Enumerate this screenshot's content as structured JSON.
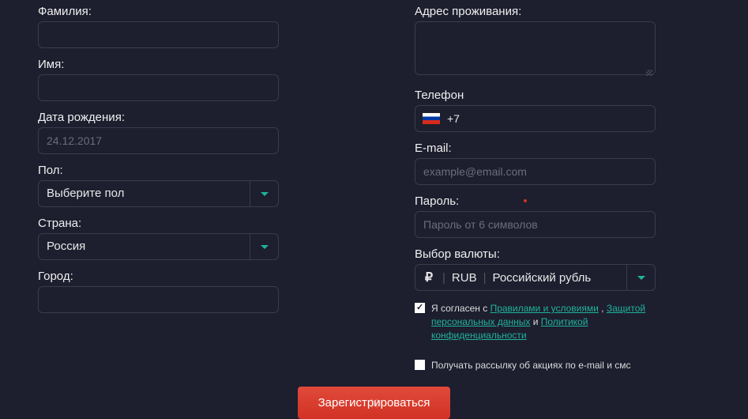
{
  "left": {
    "lastname_label": "Фамилия:",
    "firstname_label": "Имя:",
    "dob_label": "Дата рождения:",
    "dob_placeholder": "24.12.2017",
    "gender_label": "Пол:",
    "gender_value": "Выберите пол",
    "country_label": "Страна:",
    "country_value": "Россия",
    "city_label": "Город:"
  },
  "right": {
    "address_label": "Адрес проживания:",
    "phone_label": "Телефон",
    "phone_prefix": "+7",
    "email_label": "E-mail:",
    "email_placeholder": "example@email.com",
    "password_label": "Пароль:",
    "password_placeholder": "Пароль от 6 символов",
    "currency_label": "Выбор валюты:",
    "currency_code": "RUB",
    "currency_name": "Российский рубль"
  },
  "checks": {
    "agree_prefix": "Я согласен с ",
    "rules_link": "Правилами и условиями",
    "sep1": " , ",
    "privacy_link": "Защитой персональных данных",
    "sep2": " и ",
    "policy_link": "Политикой конфиденциальности",
    "newsletter": "Получать рассылку об акциях по e-mail и смс"
  },
  "submit_label": "Зарегистрироваться"
}
